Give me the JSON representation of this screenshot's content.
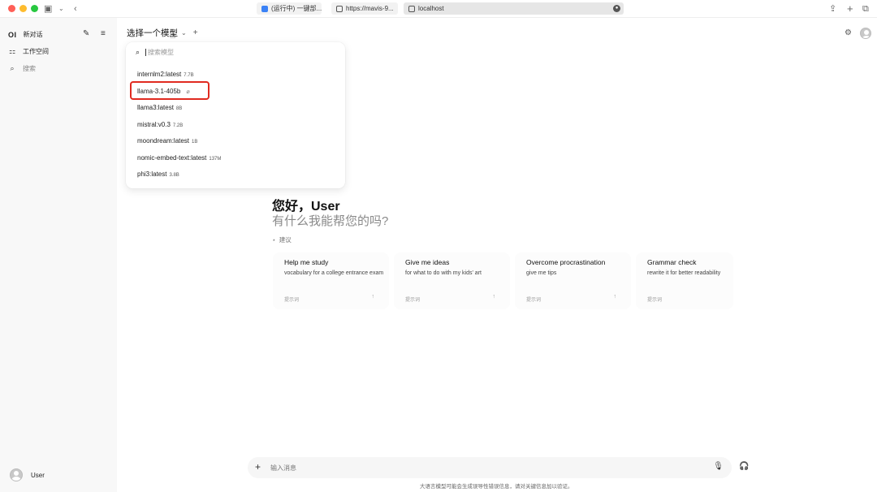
{
  "browser": {
    "tabs": [
      {
        "title": "(运行中) 一键部..."
      },
      {
        "title": "https://mavis-9..."
      },
      {
        "title": "localhost"
      }
    ],
    "icons": {
      "sidebar": "sidebar-toggle-icon",
      "back": "chevron-left-icon",
      "share": "share-icon",
      "new_tab": "plus-icon",
      "tabs": "tab-overview-icon"
    }
  },
  "sidebar": {
    "logo": "OI",
    "new_chat": "新对话",
    "workspace": "工作空间",
    "search": "搜索",
    "user_name": "User"
  },
  "header": {
    "model_select_label": "选择一个模型"
  },
  "dropdown": {
    "search_placeholder": "搜索模型",
    "models": [
      {
        "name": "internlm2:latest",
        "size": "7.7B"
      },
      {
        "name": "llama-3.1-405b",
        "size": ""
      },
      {
        "name": "llama3:latest",
        "size": "8B"
      },
      {
        "name": "mistral:v0.3",
        "size": "7.2B"
      },
      {
        "name": "moondream:latest",
        "size": "1B"
      },
      {
        "name": "nomic-embed-text:latest",
        "size": "137M"
      },
      {
        "name": "phi3:latest",
        "size": "3.8B"
      }
    ]
  },
  "main": {
    "greeting": "您好，User",
    "subgreeting": "有什么我能帮您的吗?",
    "suggestions_label": "建议",
    "cards": [
      {
        "title": "Help me study",
        "desc": "vocabulary for a college entrance exam",
        "foot": "提示词"
      },
      {
        "title": "Give me ideas",
        "desc": "for what to do with my kids' art",
        "foot": "提示词"
      },
      {
        "title": "Overcome procrastination",
        "desc": "give me tips",
        "foot": "提示词"
      },
      {
        "title": "Grammar check",
        "desc": "rewrite it for better readability",
        "foot": "提示词"
      }
    ]
  },
  "input": {
    "placeholder": "输入消息"
  },
  "footer": {
    "disclaimer": "大语言模型可能会生成误导性错误信息，请对关键信息加以验证。"
  },
  "colors": {
    "highlight": "#e02b20",
    "sidebar_bg": "#f8f8f8"
  }
}
